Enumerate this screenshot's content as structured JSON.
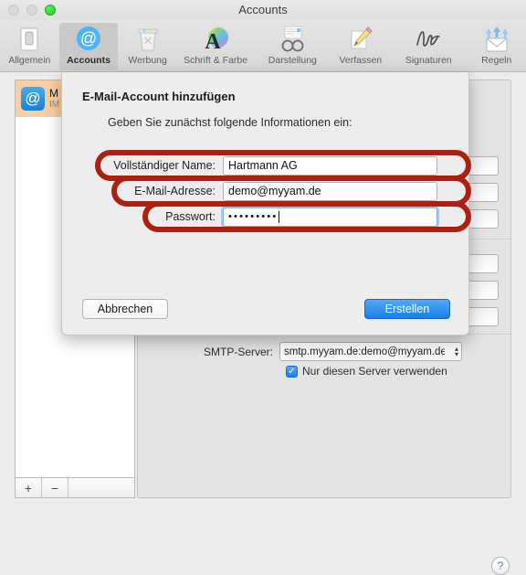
{
  "window": {
    "title": "Accounts",
    "traffic_lights": [
      {
        "name": "close",
        "state": "disabled"
      },
      {
        "name": "minimize",
        "state": "disabled"
      },
      {
        "name": "zoom",
        "state": "enabled",
        "color": "#2ac52a"
      }
    ]
  },
  "toolbar": {
    "items": [
      {
        "label": "Allgemein",
        "icon": "general-icon",
        "selected": false
      },
      {
        "label": "Accounts",
        "icon": "at-sign-icon",
        "selected": true
      },
      {
        "label": "Werbung",
        "icon": "junk-trash-icon",
        "selected": false
      },
      {
        "label": "Schrift & Farbe",
        "icon": "font-color-icon",
        "selected": false
      },
      {
        "label": "Darstellung",
        "icon": "glasses-icon",
        "selected": false
      },
      {
        "label": "Verfassen",
        "icon": "pencil-note-icon",
        "selected": false
      },
      {
        "label": "Signaturen",
        "icon": "signature-icon",
        "selected": false
      },
      {
        "label": "Regeln",
        "icon": "rules-envelope-icon",
        "selected": false
      }
    ]
  },
  "sidebar": {
    "account": {
      "name": "M",
      "type": "IM",
      "icon": "at-sign-account-icon"
    },
    "add_label": "+",
    "remove_label": "−"
  },
  "detail": {
    "smtp_label": "SMTP-Server:",
    "smtp_value": "smtp.myyam.de:demo@myyam.de",
    "smtp_checkbox_label": "Nur diesen Server verwenden",
    "smtp_checkbox_checked": true,
    "checkbox_glyph": "✓",
    "stepper_up": "▴",
    "stepper_down": "▾"
  },
  "sheet": {
    "title": "E-Mail-Account hinzufügen",
    "subtitle": "Geben Sie zunächst folgende Informationen ein:",
    "fields": [
      {
        "label": "Vollständiger Name:",
        "value": "Hartmann AG",
        "type": "text",
        "focused": false,
        "highlighted": true
      },
      {
        "label": "E-Mail-Adresse:",
        "value": "demo@myyam.de",
        "type": "text",
        "focused": false,
        "highlighted": true
      },
      {
        "label": "Passwort:",
        "value": "•••••••••",
        "type": "password",
        "focused": true,
        "highlighted": true
      }
    ],
    "cancel_label": "Abbrechen",
    "create_label": "Erstellen"
  },
  "help": {
    "label": "?"
  },
  "colors": {
    "annotation_red": "#ac1f11",
    "accent_blue": "#1b7ee8",
    "selection_orange": "#f7cfa3"
  }
}
